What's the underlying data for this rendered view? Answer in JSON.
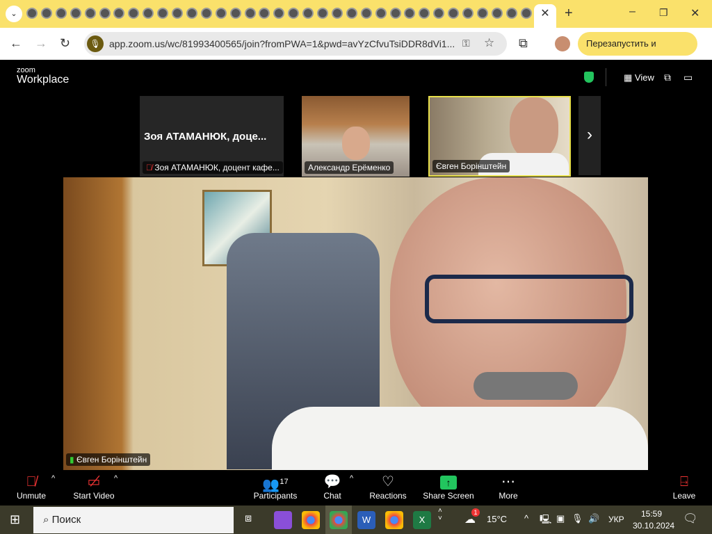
{
  "browser": {
    "url": "app.zoom.us/wc/81993400565/join?fromPWA=1&pwd=avYzCfvuTsiDDR8dVi1...",
    "relaunch_label": "Перезапустить и обновить"
  },
  "zoom": {
    "brand_top": "zoom",
    "brand_bottom": "Workplace",
    "view_label": "View"
  },
  "thumbnails": [
    {
      "title": "Зоя АТАМАНЮК, доце...",
      "name": "Зоя АТАМАНЮК, доцент кафе...",
      "muted": true
    },
    {
      "name": "Александр Ерёменко"
    },
    {
      "name": "Євген Борінштейн",
      "active": true
    }
  ],
  "main_speaker": "Євген Борінштейн",
  "toolbar": {
    "unmute": "Unmute",
    "start_video": "Start Video",
    "participants": "Participants",
    "participants_count": "17",
    "chat": "Chat",
    "reactions": "Reactions",
    "share_screen": "Share Screen",
    "more": "More",
    "leave": "Leave"
  },
  "taskbar": {
    "search_placeholder": "Поиск",
    "weather": "15°C",
    "weather_badge": "1",
    "lang": "УКР",
    "time": "15:59",
    "date": "30.10.2024"
  }
}
